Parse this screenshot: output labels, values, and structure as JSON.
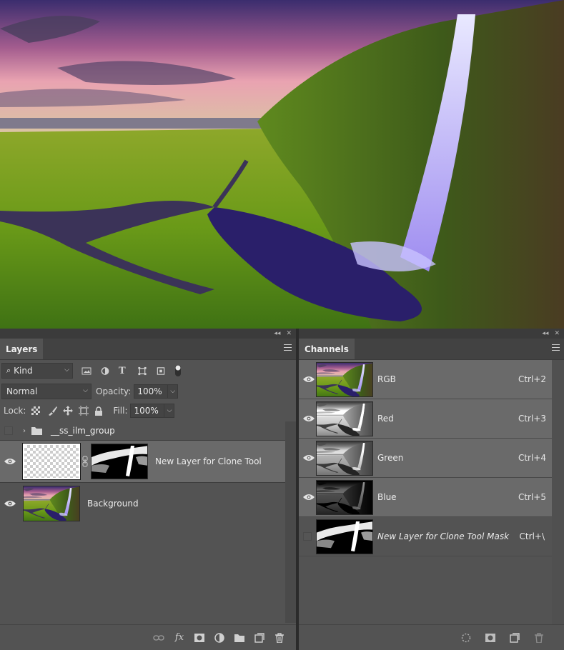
{
  "layers_panel": {
    "tab": "Layers",
    "filter": {
      "kind": "Kind"
    },
    "blend_mode": "Normal",
    "opacity_label": "Opacity:",
    "opacity_value": "100%",
    "lock_label": "Lock:",
    "fill_label": "Fill:",
    "fill_value": "100%",
    "group_name": "__ss_ilm_group",
    "layers": [
      {
        "name": "New Layer for Clone Tool",
        "visible": true,
        "selected": true,
        "has_mask": true
      },
      {
        "name": "Background",
        "visible": true,
        "selected": false,
        "has_mask": false
      }
    ],
    "bottom_icons": [
      "link-icon",
      "fx-icon",
      "add-mask-icon",
      "adjustment-icon",
      "folder-icon",
      "new-layer-icon",
      "trash-icon"
    ],
    "fx_label": "fx"
  },
  "channels_panel": {
    "tab": "Channels",
    "channels": [
      {
        "name": "RGB",
        "shortcut": "Ctrl+2",
        "visible": true
      },
      {
        "name": "Red",
        "shortcut": "Ctrl+3",
        "visible": true
      },
      {
        "name": "Green",
        "shortcut": "Ctrl+4",
        "visible": true
      },
      {
        "name": "Blue",
        "shortcut": "Ctrl+5",
        "visible": true
      },
      {
        "name": "New Layer for Clone Tool Mask",
        "shortcut": "Ctrl+\\",
        "visible": false
      }
    ],
    "bottom_icons": [
      "selection-icon",
      "save-mask-icon",
      "new-channel-icon",
      "trash-icon"
    ]
  },
  "panel_header": {
    "collapse": "◂◂",
    "close": "✕"
  }
}
